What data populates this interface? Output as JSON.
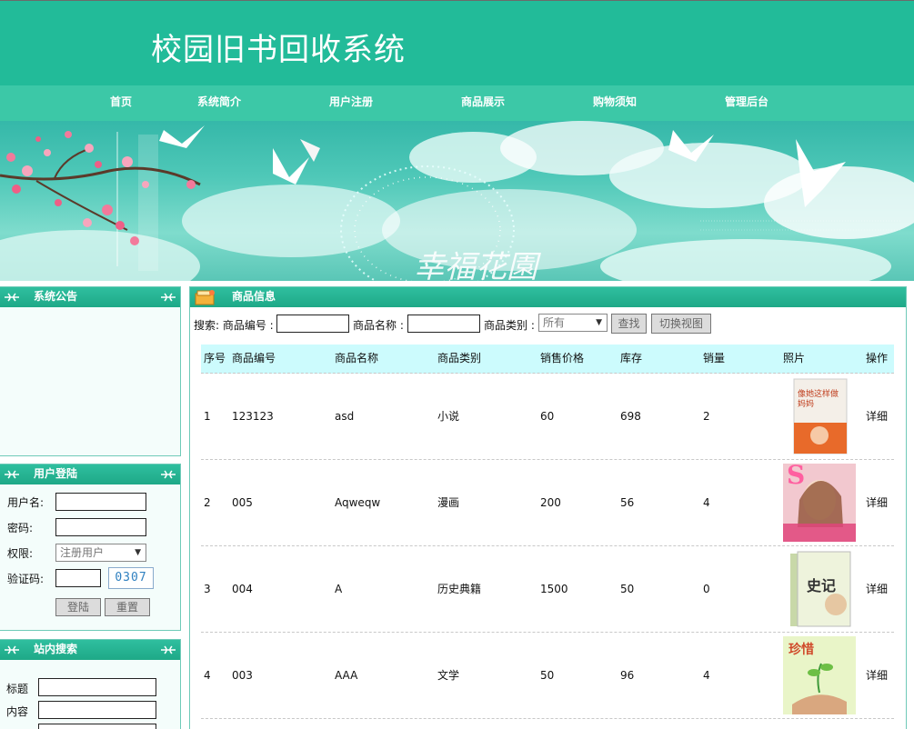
{
  "site": {
    "title": "校园旧书回收系统"
  },
  "nav": {
    "items": [
      "首页",
      "系统简介",
      "用户注册",
      "商品展示",
      "购物须知",
      "管理后台"
    ]
  },
  "banner": {
    "text": "幸福花園"
  },
  "notice": {
    "title": "系统公告"
  },
  "login": {
    "title": "用户登陆",
    "username_label": "用户名:",
    "password_label": "密码:",
    "role_label": "权限:",
    "role_value": "注册用户",
    "captcha_label": "验证码:",
    "captcha_code": "0307",
    "login_button": "登陆",
    "reset_button": "重置"
  },
  "site_search": {
    "title": "站内搜索",
    "title_label": "标题",
    "content_label": "内容"
  },
  "products": {
    "title": "商品信息",
    "search_prefix": "搜索: 商品编号 :",
    "name_label": "商品名称 :",
    "category_label": "商品类别 :",
    "category_value": "所有",
    "find_button": "查找",
    "switch_button": "切换视图",
    "columns": [
      "序号",
      "商品编号",
      "商品名称",
      "商品类别",
      "销售价格",
      "库存",
      "销量",
      "照片",
      "操作"
    ],
    "rows": [
      {
        "no": "1",
        "code": "123123",
        "name": "asd",
        "category": "小说",
        "price": "60",
        "stock": "698",
        "sold": "2",
        "action": "详细",
        "cover_text": "像她这样做妈妈"
      },
      {
        "no": "2",
        "code": "005",
        "name": "Aqweqw",
        "category": "漫画",
        "price": "200",
        "stock": "56",
        "sold": "4",
        "action": "详细",
        "cover_text": "S"
      },
      {
        "no": "3",
        "code": "004",
        "name": "A",
        "category": "历史典籍",
        "price": "1500",
        "stock": "50",
        "sold": "0",
        "action": "详细",
        "cover_text": "史记"
      },
      {
        "no": "4",
        "code": "003",
        "name": "AAA",
        "category": "文学",
        "price": "50",
        "stock": "96",
        "sold": "4",
        "action": "详细",
        "cover_text": "珍惜"
      }
    ]
  }
}
